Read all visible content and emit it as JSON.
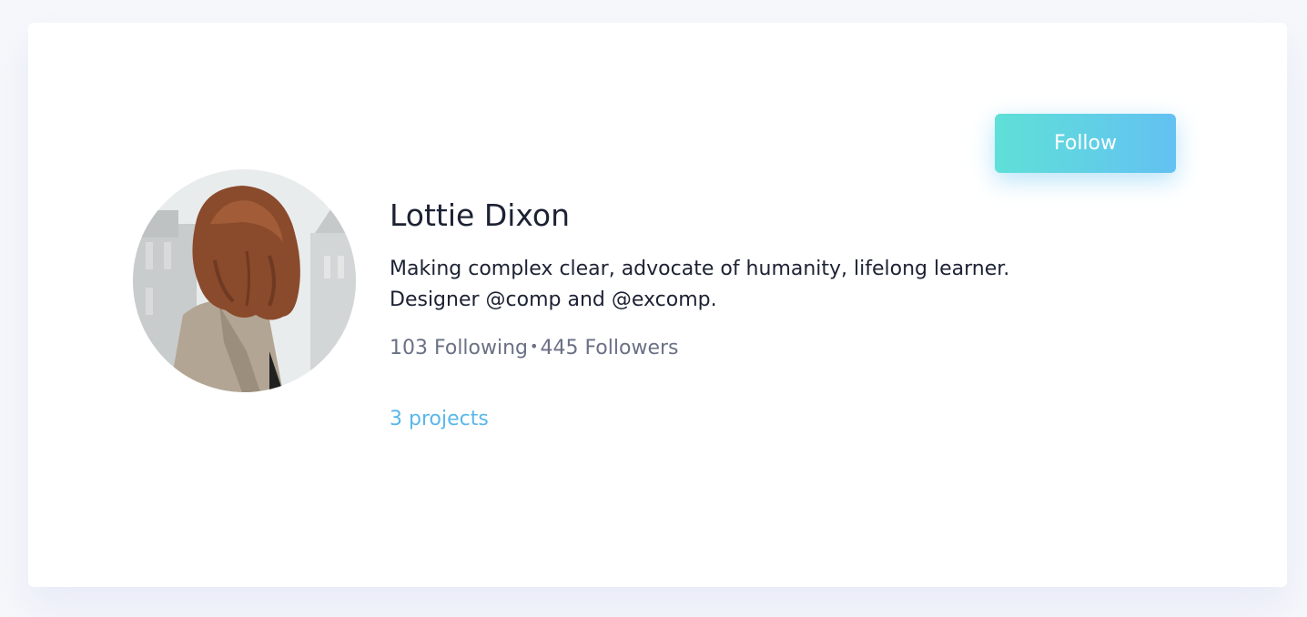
{
  "profile": {
    "name": "Lottie Dixon",
    "bio_line1": "Making complex clear, advocate of humanity, lifelong learner.",
    "bio_line2": "Designer @comp and @excomp.",
    "following": "103 Following",
    "separator": "•",
    "followers": "445 Followers",
    "projects": "3 projects",
    "avatar_icon": "avatar-photo"
  },
  "actions": {
    "follow_label": "Follow"
  },
  "colors": {
    "accent": "#5ab7ea",
    "button_gradient_start": "#5fe0d7",
    "button_gradient_end": "#63c1f2",
    "text_primary": "#1c2233",
    "text_secondary": "#6a7185"
  }
}
